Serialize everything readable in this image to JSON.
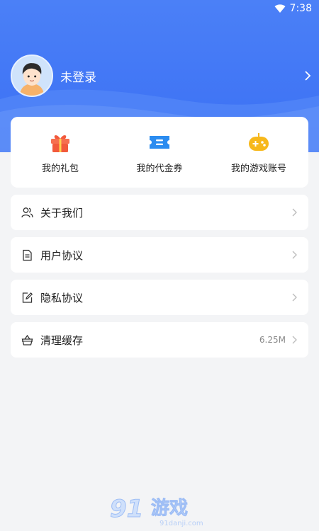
{
  "status_bar": {
    "time": "7:38",
    "icons": [
      "wifi-icon",
      "battery-icon"
    ]
  },
  "profile": {
    "login_text": "未登录"
  },
  "quick_actions": [
    {
      "label": "我的礼包",
      "icon": "gift-icon"
    },
    {
      "label": "我的代金券",
      "icon": "coupon-icon"
    },
    {
      "label": "我的游戏账号",
      "icon": "gamepad-icon"
    }
  ],
  "menu": [
    {
      "label": "关于我们",
      "icon": "users-icon"
    },
    {
      "label": "用户协议",
      "icon": "document-icon"
    },
    {
      "label": "隐私协议",
      "icon": "edit-document-icon"
    },
    {
      "label": "清理缓存",
      "icon": "basket-icon",
      "value": "6.25M"
    }
  ],
  "watermark": {
    "brand": "91游戏",
    "url": "91danji.com"
  },
  "colors": {
    "header": "#3b70f4",
    "background": "#f3f4f6",
    "gift": "#f25a3c",
    "coupon": "#2b8cf0",
    "gamepad": "#f7b81b"
  }
}
